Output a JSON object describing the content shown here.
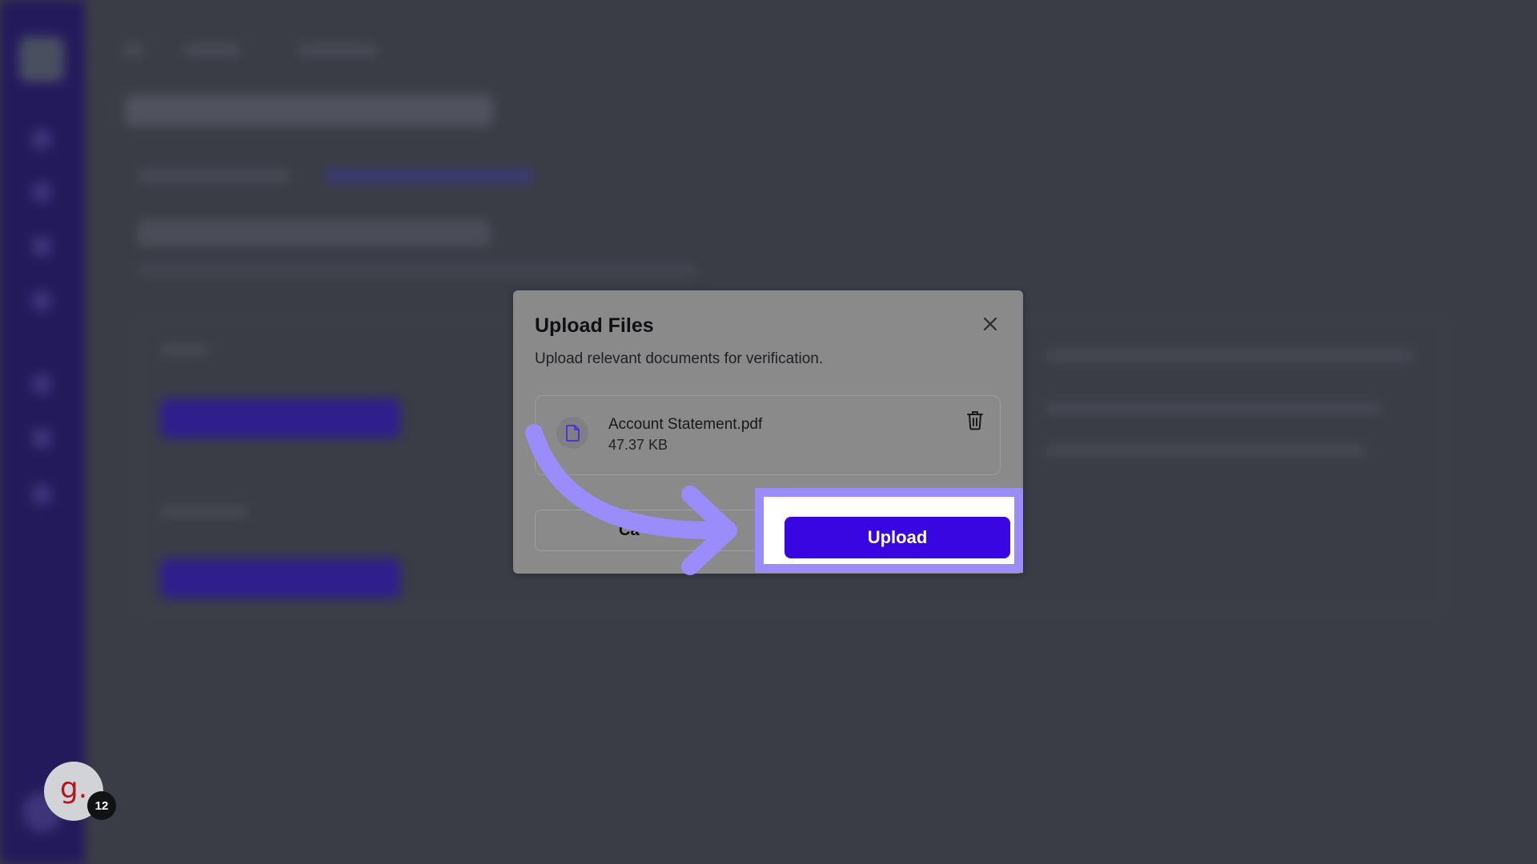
{
  "modal": {
    "title": "Upload Files",
    "description": "Upload relevant documents for verification.",
    "file": {
      "name": "Account Statement.pdf",
      "size": "47.37 KB"
    },
    "cancel_label": "Ca",
    "upload_label": "Upload"
  },
  "icons": {
    "close": "close-icon",
    "file": "file-icon",
    "trash": "trash-icon",
    "arrow": "arrow-annotation"
  },
  "badge": {
    "letter": "g.",
    "count": "12"
  },
  "colors": {
    "highlight": "#9b8cfb",
    "upload_button": "#3806e0",
    "sidebar": "#231a5c",
    "badge_letter": "#b3161f"
  }
}
